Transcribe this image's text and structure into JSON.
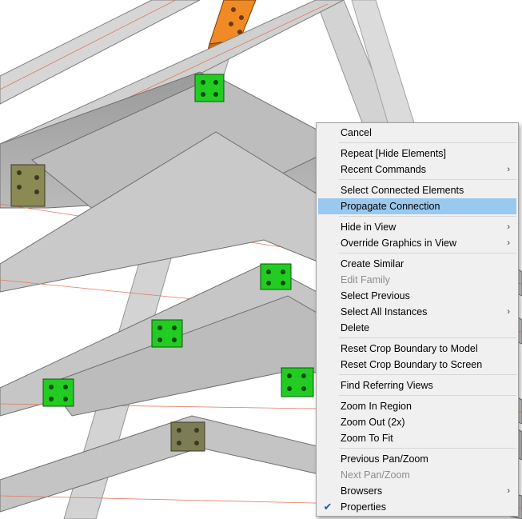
{
  "menu": {
    "groups": [
      [
        {
          "label": "Cancel"
        }
      ],
      [
        {
          "label": "Repeat [Hide Elements]"
        },
        {
          "label": "Recent Commands",
          "submenu": true
        }
      ],
      [
        {
          "label": "Select Connected Elements"
        },
        {
          "label": "Propagate Connection",
          "highlighted": true
        }
      ],
      [
        {
          "label": "Hide in View",
          "submenu": true
        },
        {
          "label": "Override Graphics in View",
          "submenu": true
        }
      ],
      [
        {
          "label": "Create Similar"
        },
        {
          "label": "Edit Family",
          "disabled": true
        },
        {
          "label": "Select Previous"
        },
        {
          "label": "Select All Instances",
          "submenu": true
        },
        {
          "label": "Delete"
        }
      ],
      [
        {
          "label": "Reset Crop Boundary to Model"
        },
        {
          "label": "Reset Crop Boundary to Screen"
        }
      ],
      [
        {
          "label": "Find Referring Views"
        }
      ],
      [
        {
          "label": "Zoom In Region"
        },
        {
          "label": "Zoom Out (2x)"
        },
        {
          "label": "Zoom To Fit"
        }
      ],
      [
        {
          "label": "Previous Pan/Zoom"
        },
        {
          "label": "Next Pan/Zoom",
          "disabled": true
        },
        {
          "label": "Browsers",
          "submenu": true
        },
        {
          "label": "Properties",
          "checked": true
        }
      ]
    ]
  },
  "colors": {
    "highlight": "#99c9ef",
    "menu_bg": "#f0f0f0",
    "steel_gray": "#c8c8c8",
    "connection_green": "#22cc22",
    "beam_orange": "#f08a24",
    "outline_red": "#e07a5f"
  },
  "icons": {
    "submenu": "chevron-right-icon",
    "check": "checkmark-icon"
  }
}
